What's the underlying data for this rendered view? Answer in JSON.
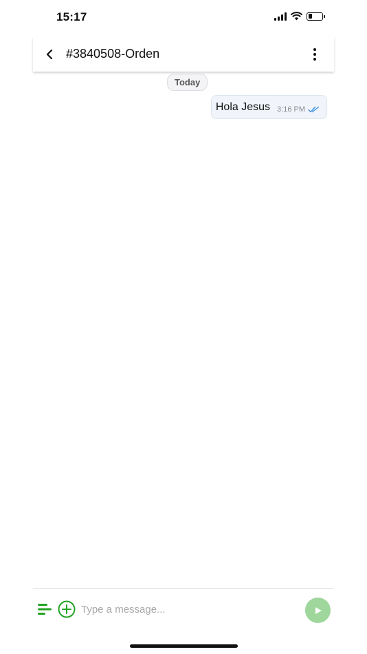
{
  "status_bar": {
    "time": "15:17",
    "icons": [
      "cellular-signal-icon",
      "wifi-icon",
      "battery-icon"
    ],
    "battery_level": 0.3
  },
  "header": {
    "title": "#3840508-Orden",
    "back_icon": "chevron-left-icon",
    "menu_icon": "more-vertical-icon"
  },
  "chat": {
    "date_separator": "Today",
    "messages": [
      {
        "text": "Hola Jesus",
        "time": "3:16 PM",
        "status_icon": "double-check-icon",
        "outgoing": true
      }
    ]
  },
  "composer": {
    "value": "",
    "placeholder": "Type a message...",
    "menu_icon": "menu-lines-icon",
    "add_icon": "plus-circle-icon",
    "send_icon": "send-arrow-icon"
  },
  "colors": {
    "accent_green": "#23a323",
    "send_button_bg": "#9fd69c",
    "read_receipt_blue": "#3b8fe0",
    "bubble_bg": "#f1f5fb"
  }
}
